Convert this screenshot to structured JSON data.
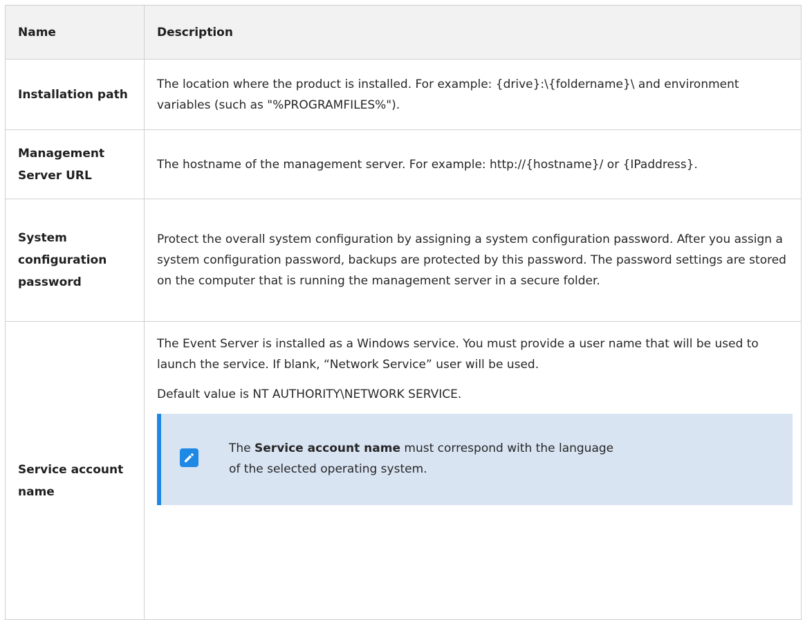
{
  "table": {
    "headers": {
      "name": "Name",
      "description": "Description"
    },
    "rows": [
      {
        "name": "Installation path",
        "description": "The location where the product is installed. For example: {drive}:\\{foldername}\\ and environment variables (such as \"%PROGRAMFILES%\")."
      },
      {
        "name": "Management Server URL",
        "description": "The hostname of the management server. For example: http://{hostname}/ or {IPaddress}."
      },
      {
        "name": "System configuration password",
        "description": "Protect the overall system configuration by assigning a system configuration password. After you assign a system configuration password, backups are protected by this password. The password settings are stored on the computer that is running the management server in a secure folder."
      },
      {
        "name": "Service account name",
        "description_p1": "The Event Server is installed as a Windows service. You must provide a user name that will be used to launch the service. If blank, “Network Service” user will be used.",
        "description_p2": "Default value is NT AUTHORITY\\NETWORK SERVICE.",
        "note": {
          "icon": "edit-pencil-icon",
          "prefix": "The ",
          "bold": "Service account name",
          "suffix": " must correspond with the language of the selected operating system."
        }
      }
    ]
  },
  "colors": {
    "header_bg": "#f2f2f2",
    "border": "#d0d0d0",
    "note_bg": "#d9e4f3",
    "accent": "#1e88e5"
  }
}
